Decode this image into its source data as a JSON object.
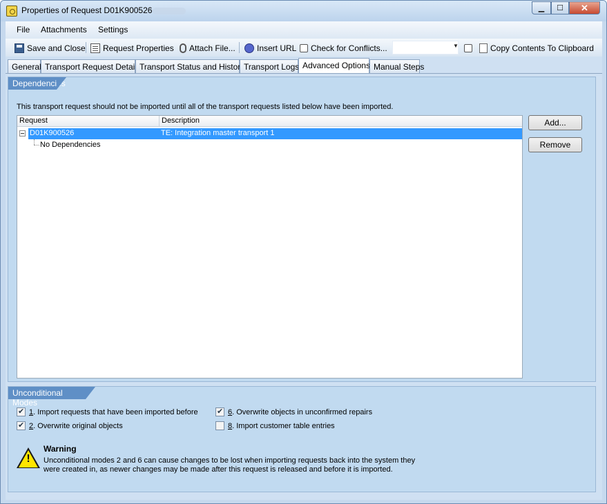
{
  "window": {
    "title": "Properties of Request D01K900526",
    "min_label": "▁",
    "max_label": "☐",
    "close_label": "✕"
  },
  "menu": {
    "file": "File",
    "attachments": "Attachments",
    "settings": "Settings"
  },
  "toolbar": {
    "save_close": "Save and Close",
    "request_properties": "Request Properties",
    "attach_file": "Attach File...",
    "insert_url": "Insert URL",
    "check_conflicts": "Check for Conflicts...",
    "conflicts_combo_value": "",
    "copy_contents": "Copy Contents To Clipboard"
  },
  "tabs": [
    {
      "label": "General"
    },
    {
      "label": "Transport Request Details"
    },
    {
      "label": "Transport Status and History"
    },
    {
      "label": "Transport Logs"
    },
    {
      "label": "Advanced Options"
    },
    {
      "label": "Manual Steps"
    }
  ],
  "active_tab": "Advanced Options",
  "dependencies": {
    "header": "Dependencies",
    "description": "This transport request should not be imported until all of the transport requests listed below have been imported.",
    "columns": [
      "Request",
      "Description"
    ],
    "rows": [
      {
        "request": "D01K900526",
        "description": "TE: Integration master transport 1",
        "selected": true,
        "children": [
          {
            "request": "No Dependencies"
          }
        ]
      }
    ],
    "add_button": "Add...",
    "remove_button": "Remove"
  },
  "unconditional_modes": {
    "header": "Unconditional Modes",
    "options": [
      {
        "number": "1",
        "label": ". Import requests that have been imported before",
        "checked": true
      },
      {
        "number": "2",
        "label": ". Overwrite original objects",
        "checked": true
      },
      {
        "number": "6",
        "label": ". Overwrite objects in unconfirmed repairs",
        "checked": true
      },
      {
        "number": "8",
        "label": ". Import customer table entries",
        "checked": false
      }
    ],
    "warning_title": "Warning",
    "warning_text": "Unconditional modes 2 and 6 can cause changes to be lost when importing requests back into the system they were created in, as newer changes may be made after this request is released and before it is imported."
  },
  "colors": {
    "selection": "#3399ff",
    "group_header": "#5f8fc6",
    "panel_bg": "#c1daf0"
  }
}
